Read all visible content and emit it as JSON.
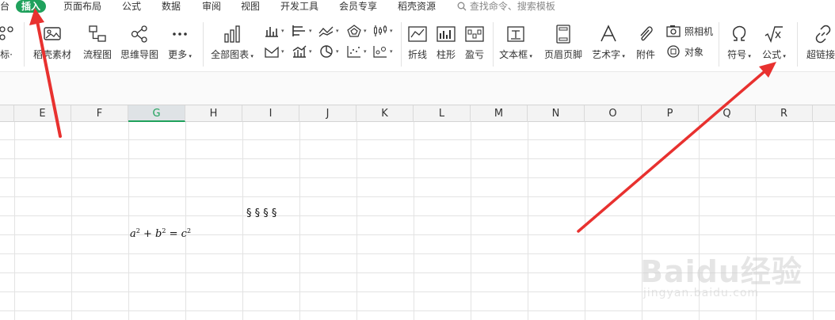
{
  "menu": {
    "partial_left": "台",
    "tabs": [
      "插入",
      "页面布局",
      "公式",
      "数据",
      "审阅",
      "视图",
      "开发工具",
      "会员专享",
      "稻壳资源"
    ],
    "active_tab": "插入",
    "search_placeholder": "查找命令、搜索模板"
  },
  "ribbon": {
    "partial_left_label": "标·",
    "material_label": "稻壳素材",
    "flowchart_label": "流程图",
    "mindmap_label": "思维导图",
    "more_label": "更多",
    "all_charts_label": "全部图表",
    "sparkline_line_label": "折线",
    "sparkline_column_label": "柱形",
    "sparkline_winloss_label": "盈亏",
    "textbox_label": "文本框",
    "header_footer_label": "页眉页脚",
    "wordart_label": "艺术字",
    "attachment_label": "附件",
    "camera_label": "照相机",
    "object_label": "对象",
    "symbol_label": "符号",
    "formula_label": "公式",
    "hyperlink_label": "超链接"
  },
  "sheet": {
    "columns": [
      "E",
      "F",
      "G",
      "H",
      "I",
      "J",
      "K",
      "L",
      "M",
      "N",
      "O",
      "P",
      "Q",
      "R"
    ],
    "selected_column": "G",
    "symbols_cell": "§ § § §",
    "formula_cell": {
      "a": "a",
      "b": "b",
      "c": "c",
      "exp": "2",
      "plus": "+",
      "eq": "="
    }
  },
  "watermark": {
    "brand": "Baidu经验",
    "url": "jingyan.baidu.com"
  },
  "colors": {
    "accent_green": "#1fa15c",
    "arrow_red": "#e8312f"
  }
}
